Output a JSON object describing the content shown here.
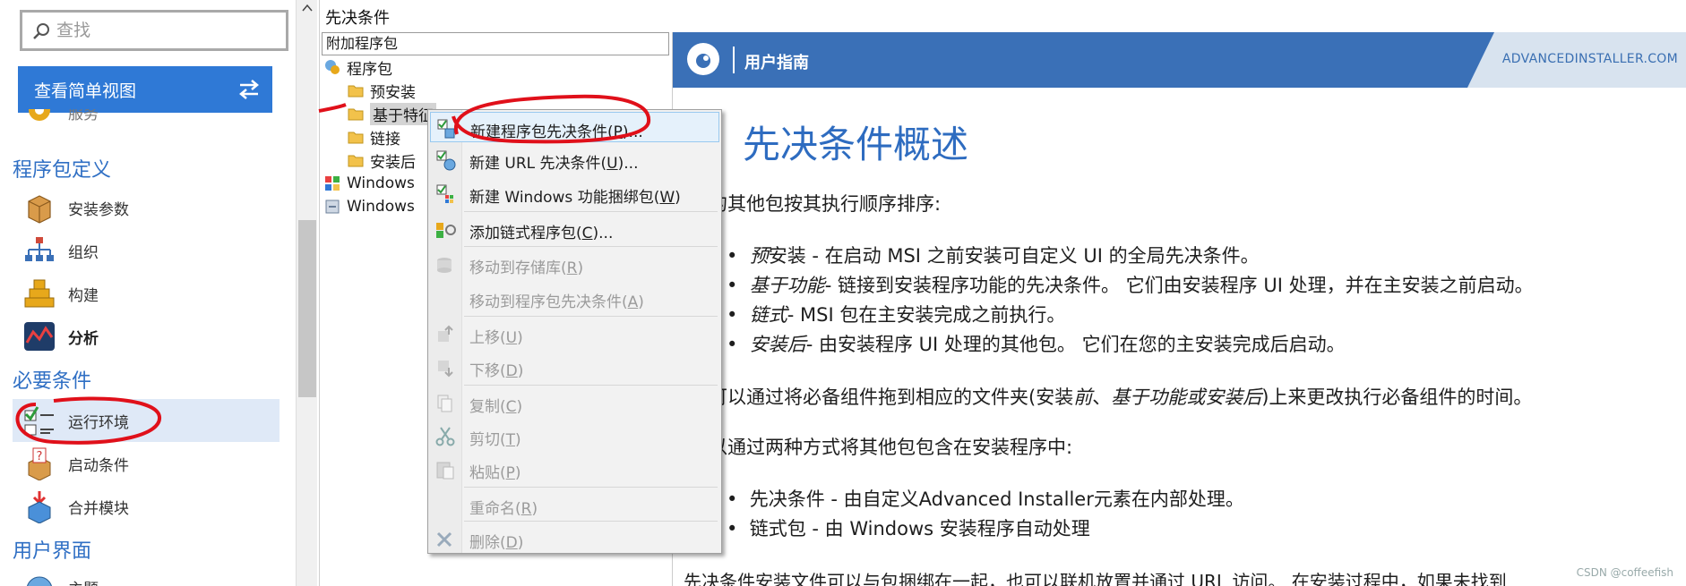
{
  "sidebar": {
    "search_placeholder": "查找",
    "simple_view_label": "查看简单视图",
    "partial_item": "服务",
    "sections": {
      "package_definition": "程序包定义",
      "requirements": "必要条件",
      "user_interface": "用户界面"
    },
    "items": {
      "install_params": "安装参数",
      "organization": "组织",
      "build": "构建",
      "analysis": "分析",
      "runtime": "运行环境",
      "launch_conditions": "启动条件",
      "merge_modules": "合并模块",
      "theme_partial": "主题"
    }
  },
  "tree": {
    "title": "先决条件",
    "attach_label": "附加程序包",
    "root": "程序包",
    "pre_install": "预安装",
    "feature_based": "基于特征",
    "chain": "链接",
    "post_install": "安装后",
    "windows_1": "Windows",
    "windows_2": "Windows"
  },
  "context_menu": {
    "items": [
      {
        "text": "新建程序包先决条件(",
        "key": "P",
        "tail": ")...",
        "disabled": false
      },
      {
        "text": "新建 URL 先决条件(",
        "key": "U",
        "tail": ")...",
        "disabled": false
      },
      {
        "text": "新建 Windows 功能捆绑包(",
        "key": "W",
        "tail": ")",
        "disabled": false
      },
      {
        "text": "添加链式程序包(",
        "key": "C",
        "tail": ")...",
        "disabled": false
      },
      {
        "text": "移动到存储库(",
        "key": "R",
        "tail": ")",
        "disabled": true
      },
      {
        "text": "移动到程序包先决条件(",
        "key": "A",
        "tail": ")",
        "disabled": true
      },
      {
        "text": "上移(",
        "key": "U",
        "tail": ")",
        "disabled": true
      },
      {
        "text": "下移(",
        "key": "D",
        "tail": ")",
        "disabled": true
      },
      {
        "text": "复制(",
        "key": "C",
        "tail": ")",
        "disabled": true
      },
      {
        "text": "剪切(",
        "key": "T",
        "tail": ")",
        "disabled": true
      },
      {
        "text": "粘贴(",
        "key": "P",
        "tail": ")",
        "disabled": true
      },
      {
        "text": "重命名(",
        "key": "R",
        "tail": ")",
        "disabled": true
      },
      {
        "text": "删除(",
        "key": "D",
        "tail": ")",
        "disabled": true
      }
    ]
  },
  "doc": {
    "header_label": "用户指南",
    "brand": "ADVANCEDINSTALLER.COM",
    "heading": "先决条件概述",
    "p1": "的其他包按其执行顺序排序:",
    "b1_em": "预",
    "b1_rest": "安装 - 在启动 MSI 之前安装可自定义 UI 的全局先决条件。",
    "b2_em": "基于功能",
    "b2_rest": "- 链接到安装程序功能的先决条件。 它们由安装程序 UI 处理，并在主安装之前启动。",
    "b3_em": "链式",
    "b3_rest": "- MSI 包在主安装完成之前执行。",
    "b4_em": "安装后",
    "b4_rest": "- 由安装程序 UI 处理的其他包。 它们在您的主安装完成后启动。",
    "p2_a": "可以通过将必备组件拖到相应的文件夹(安装",
    "p2_em1": "前",
    "p2_b": "、",
    "p2_em2": "基于功能或安装后",
    "p2_c": ")上来更改执行必备组件的时间。",
    "p3": "以通过两种方式将其他包包含在安装程序中:",
    "c1": "先决条件 - 由自定义Advanced Installer元素在内部处理。",
    "c2": "链式包 - 由 Windows 安装程序自动处理",
    "p4": "先决条件安装文件可以与包捆绑在一起，也可以联机放置并通过 URL 访问。 在安装过程中，如果未找到",
    "watermark": "CSDN @coffeefish"
  },
  "colors": {
    "accent_blue": "#2f79d6",
    "header_blue": "#3a70b7",
    "section_blue": "#2f6fc4",
    "annotation_red": "#e0101a"
  }
}
